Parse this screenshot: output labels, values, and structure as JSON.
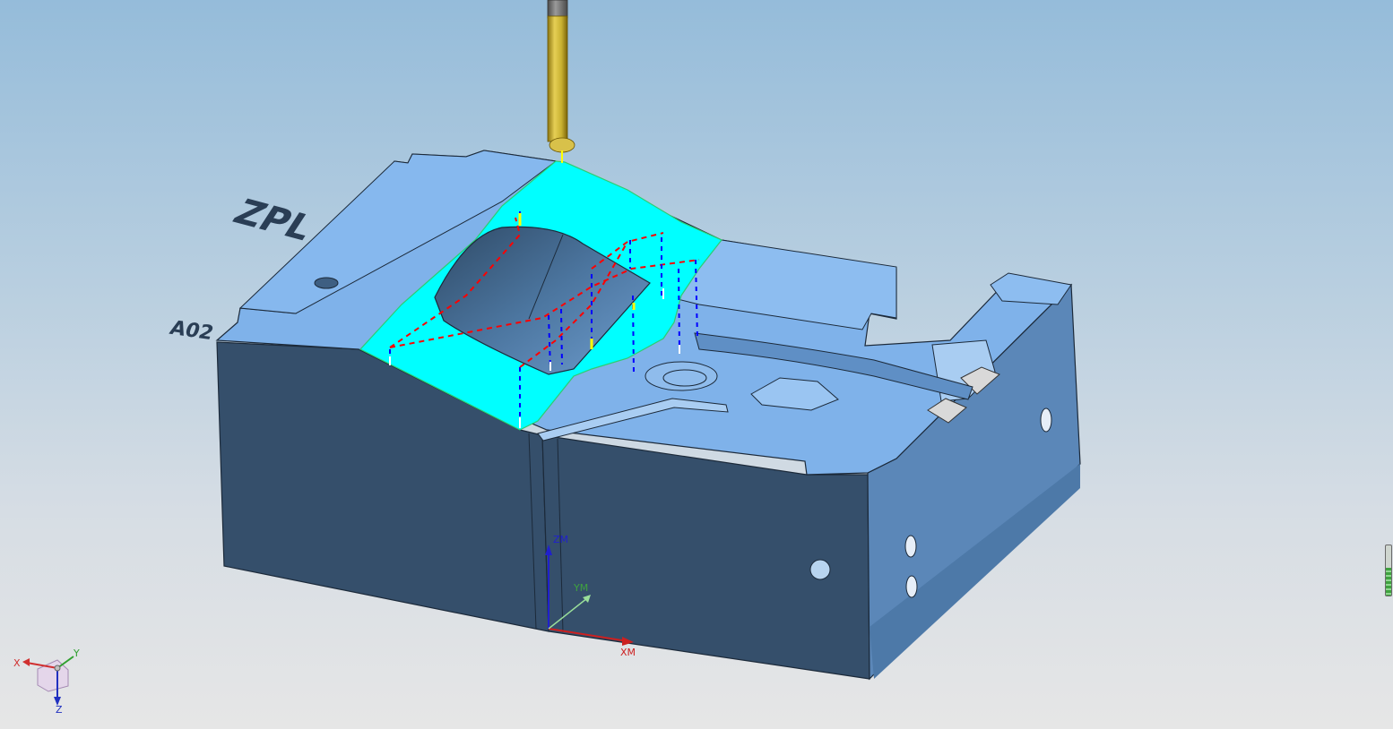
{
  "part": {
    "engraving_main": "ZPL",
    "engraving_side": "A02"
  },
  "work_axes": {
    "x": "XM",
    "y": "YM",
    "z": "ZM"
  },
  "view_triad": {
    "x": "X",
    "y": "Y",
    "z": "Z"
  },
  "colors": {
    "part_top": "#7fb2ea",
    "part_side_dark": "#354f6b",
    "part_side_light": "#5b87b8",
    "machined_region": "#00ffff",
    "tool_holder": "#7b7b7b",
    "tool_body": "#c8b030",
    "rapid_move": "#ff0000",
    "engage_move": "#0000ff",
    "cut_move": "#ffff00"
  },
  "status_progress": {
    "percent": 55
  }
}
